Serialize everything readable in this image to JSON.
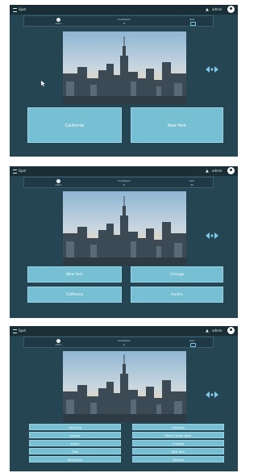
{
  "topbar": {
    "app_name": "Spot",
    "username": "admin"
  },
  "status": {
    "player_name": "admin",
    "points_label": "Punktezahl",
    "points_value": "0",
    "time_label": "Zeit",
    "time_value": "11",
    "points_value_3": "2"
  },
  "icons": {
    "menu": "menu-icon",
    "bell": "bell-icon",
    "avatar": "account-circle-icon",
    "player": "person-icon",
    "tv": "tv-icon",
    "swap": "double-arrow-icon"
  },
  "colors": {
    "app_bg": "#264552",
    "topbar": "#1a2e36",
    "answer_bg": "#77c0d4"
  },
  "photo": {
    "description": "Manhattan skyline"
  },
  "screen1": {
    "answers": [
      "California",
      "New York"
    ]
  },
  "screen2": {
    "answers": [
      "New York",
      "Chicago",
      "California",
      "Austin"
    ]
  },
  "screen3": {
    "answers_left": [
      "California",
      "Sydney",
      "Austin",
      "Ohio",
      "Stockholm"
    ],
    "answers_right": [
      "Hamilton",
      "Rhine Center Bank",
      "Chicago",
      "New York",
      "Warsaw"
    ]
  }
}
